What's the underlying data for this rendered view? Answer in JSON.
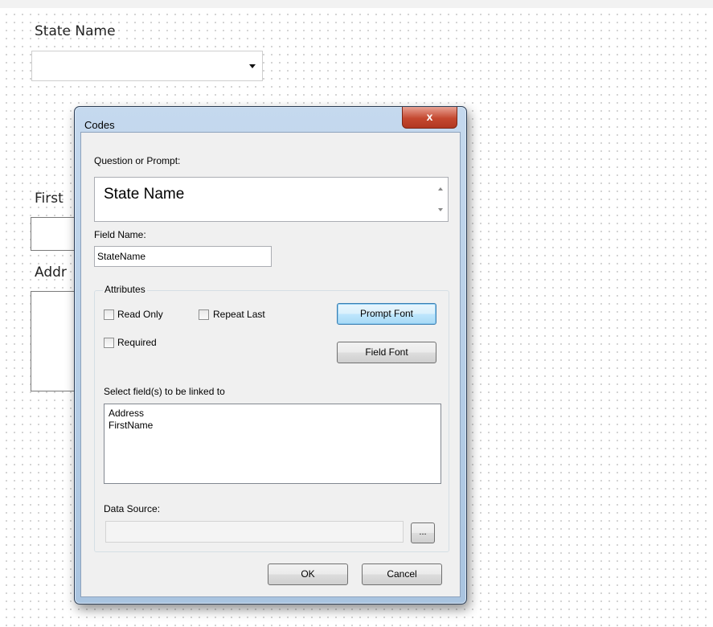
{
  "background": {
    "state_label": "State Name",
    "first_label": "First",
    "addr_label": "Addr"
  },
  "dialog": {
    "title": "Codes",
    "close_glyph": "x",
    "question_label": "Question or Prompt:",
    "prompt_text": "State Name",
    "field_name_label": "Field Name:",
    "field_name_value": "StateName",
    "attributes_label": "Attributes",
    "read_only_label": "Read Only",
    "repeat_last_label": "Repeat Last",
    "required_label": "Required",
    "prompt_font_button": "Prompt Font",
    "field_font_button": "Field Font",
    "linked_label": "Select field(s) to be linked to",
    "linked_fields": [
      "Address",
      "FirstName"
    ],
    "data_source_label": "Data Source:",
    "data_source_value": "",
    "browse_button": "...",
    "ok_button": "OK",
    "cancel_button": "Cancel"
  },
  "colors": {
    "dialog_frame": "#b7cfe8",
    "close_button": "#c4482f",
    "client_bg": "#f0f0f0"
  }
}
